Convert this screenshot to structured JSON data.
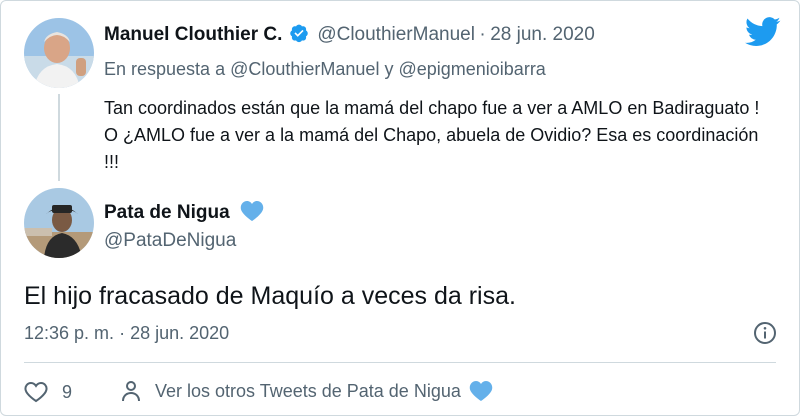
{
  "colors": {
    "twitter_blue": "#1d9bf0",
    "text_primary": "#0f1419",
    "text_secondary": "#536471",
    "border": "#cfd9de"
  },
  "quoted_tweet": {
    "author_name": "Manuel Clouthier C.",
    "author_handle": "@ClouthierManuel",
    "separator": "·",
    "date": "28 jun. 2020",
    "reply_prefix": "En respuesta a",
    "reply_user_1": "@ClouthierManuel",
    "reply_conj": "y",
    "reply_user_2": "@epigmenioibarra",
    "text": "Tan coordinados están que la mamá del chapo fue a ver a AMLO en Badiraguato ! O ¿AMLO fue a ver a la mamá del Chapo, abuela de Ovidio? Esa es coordinación !!!",
    "icons": {
      "verified": "verified-badge-icon"
    }
  },
  "main_tweet": {
    "author_name": "Pata de Nigua",
    "author_handle": "@PataDeNigua",
    "text": "El hijo fracasado de Maquío a veces da risa.",
    "time": "12:36 p. m.",
    "separator": "·",
    "date": "28 jun. 2020",
    "icons": {
      "name_badge": "blue-heart-icon",
      "info": "info-icon"
    }
  },
  "footer": {
    "like_count": "9",
    "more_tweets_label": "Ver los otros Tweets de Pata de Nigua",
    "icons": {
      "like": "heart-outline-icon",
      "person": "person-icon",
      "badge": "blue-heart-icon"
    }
  },
  "brand": {
    "logo": "twitter-bird-icon"
  }
}
